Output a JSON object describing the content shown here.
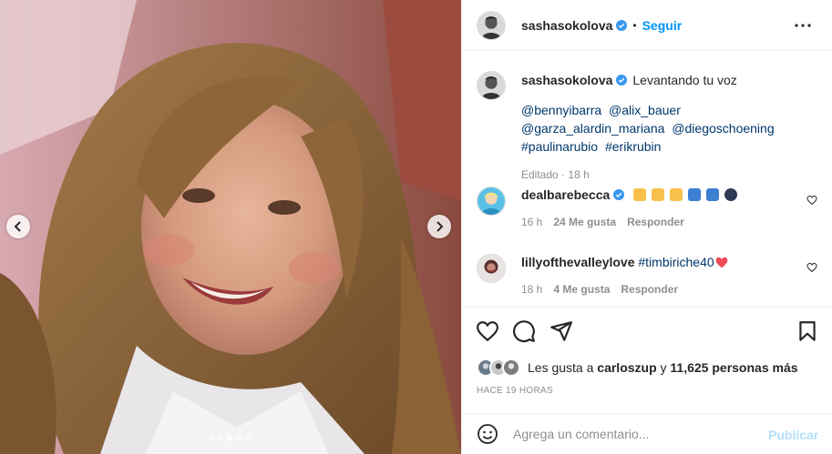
{
  "post": {
    "author": "sashasokolova",
    "follow_label": "Seguir",
    "separator": "•",
    "carousel": {
      "slide_count": 5,
      "active_index": 3
    }
  },
  "caption": {
    "username": "sashasokolova",
    "text": "Levantando tu voz",
    "tags": [
      "@bennyibarra",
      "@alix_bauer",
      "@garza_alardin_mariana",
      "@diegoschoening",
      "#paulinarubio",
      "#erikrubin"
    ],
    "edited_label": "Editado",
    "dot": "·",
    "time": "18 h"
  },
  "comments": [
    {
      "username": "dealbarebecca",
      "time": "16 h",
      "likes": "24 Me gusta",
      "reply": "Responder",
      "emojis": [
        "raised-hands",
        "raised-hands",
        "raised-hands",
        "anchor-box",
        "anchor-box",
        "submarine"
      ]
    },
    {
      "username": "lillyofthevalleylove",
      "tag": "#timbiriche40",
      "time": "18 h",
      "likes": "4 Me gusta",
      "reply": "Responder"
    }
  ],
  "likes": {
    "prefix": "Les gusta a",
    "user": "carloszup",
    "conjunction": "y",
    "count": "11,625 personas más"
  },
  "timestamp": "HACE 19 HORAS",
  "composer": {
    "placeholder": "Agrega un comentario...",
    "publish_label": "Publicar"
  },
  "colors": {
    "accent": "#0095f6",
    "link": "#00376b",
    "muted": "#8e8e8e",
    "publish_disabled": "#b2dffc",
    "heart_red": "#ed4956"
  }
}
